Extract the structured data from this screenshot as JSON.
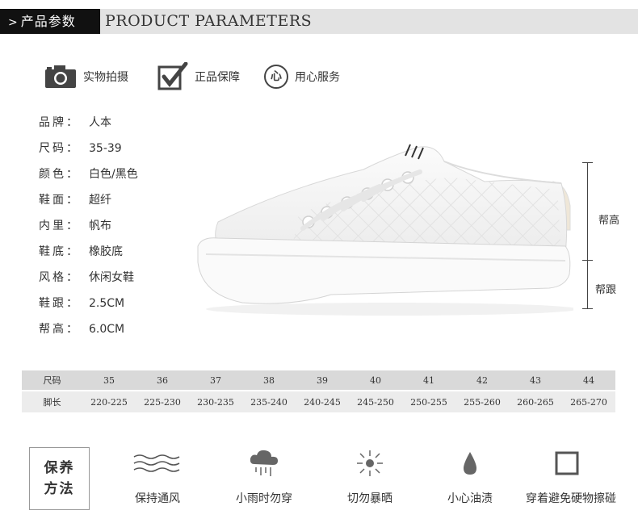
{
  "header": {
    "tag": "产品参数",
    "title": "PRODUCT PARAMETERS"
  },
  "badges": [
    {
      "icon": "camera-icon",
      "label": "实物拍摄"
    },
    {
      "icon": "checkmark-icon",
      "label": "正品保障"
    },
    {
      "icon": "heart-circle-icon",
      "icon_text": "心",
      "label": "用心服务"
    }
  ],
  "params": [
    {
      "key": "品牌：",
      "value": "人本"
    },
    {
      "key": "尺码：",
      "value": "35-39"
    },
    {
      "key": "颜色：",
      "value": "白色/黑色"
    },
    {
      "key": "鞋面：",
      "value": "超纤"
    },
    {
      "key": "内里：",
      "value": "帆布"
    },
    {
      "key": "鞋底：",
      "value": "橡胶底"
    },
    {
      "key": "风格：",
      "value": "休闲女鞋"
    },
    {
      "key": "鞋跟：",
      "value": "2.5CM"
    },
    {
      "key": "帮高：",
      "value": "6.0CM"
    }
  ],
  "dimensions": {
    "upper_label": "帮高",
    "heel_label": "帮跟"
  },
  "size_table": {
    "row1_head": "尺码",
    "row2_head": "脚长",
    "sizes": [
      "35",
      "36",
      "37",
      "38",
      "39",
      "40",
      "41",
      "42",
      "43",
      "44"
    ],
    "lengths": [
      "220-225",
      "225-230",
      "230-235",
      "235-240",
      "240-245",
      "245-250",
      "250-255",
      "255-260",
      "260-265",
      "265-270"
    ]
  },
  "care": {
    "title_line1": "保养",
    "title_line2": "方法",
    "items": [
      {
        "icon": "wind-waves-icon",
        "label": "保持通风"
      },
      {
        "icon": "rain-cloud-icon",
        "label": "小雨时勿穿"
      },
      {
        "icon": "sun-icon",
        "label": "切勿暴晒"
      },
      {
        "icon": "oil-drop-icon",
        "label": "小心油渍"
      },
      {
        "icon": "square-icon",
        "label": "穿着避免硬物擦碰"
      }
    ]
  },
  "colors": {
    "header_dark": "#111111",
    "header_bar": "#e3e3e3",
    "table_row1": "#d9d9d9",
    "table_row2": "#ececec"
  }
}
